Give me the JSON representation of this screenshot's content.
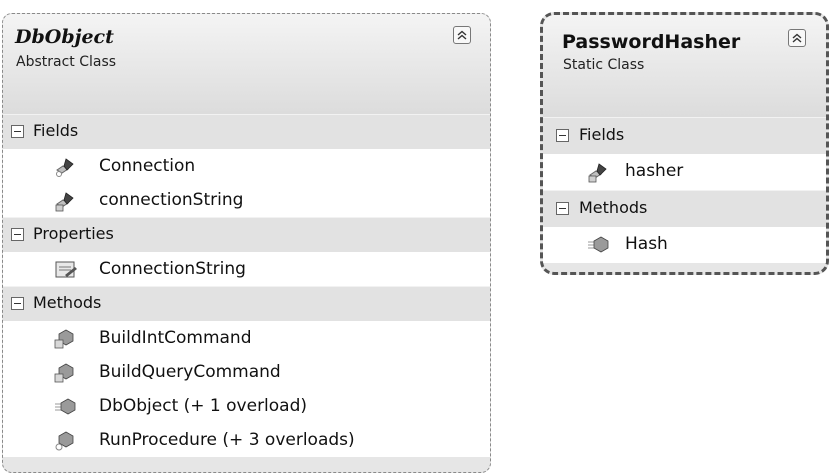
{
  "classes": [
    {
      "name": "DbObject",
      "stereotype": "Abstract Class",
      "sections": [
        {
          "label": "Fields",
          "members": [
            {
              "name": "Connection",
              "icon": "protected-field-icon"
            },
            {
              "name": "connectionString",
              "icon": "private-field-icon"
            }
          ]
        },
        {
          "label": "Properties",
          "members": [
            {
              "name": "ConnectionString",
              "icon": "property-icon"
            }
          ]
        },
        {
          "label": "Methods",
          "members": [
            {
              "name": "BuildIntCommand",
              "icon": "private-method-icon"
            },
            {
              "name": "BuildQueryCommand",
              "icon": "private-method-icon"
            },
            {
              "name": "DbObject (+ 1 overload)",
              "icon": "public-method-icon"
            },
            {
              "name": "RunProcedure (+ 3 overloads)",
              "icon": "protected-method-icon"
            }
          ]
        }
      ]
    },
    {
      "name": "PasswordHasher",
      "stereotype": "Static Class",
      "sections": [
        {
          "label": "Fields",
          "members": [
            {
              "name": "hasher",
              "icon": "private-field-icon"
            }
          ]
        },
        {
          "label": "Methods",
          "members": [
            {
              "name": "Hash",
              "icon": "public-method-icon"
            }
          ]
        }
      ]
    }
  ]
}
